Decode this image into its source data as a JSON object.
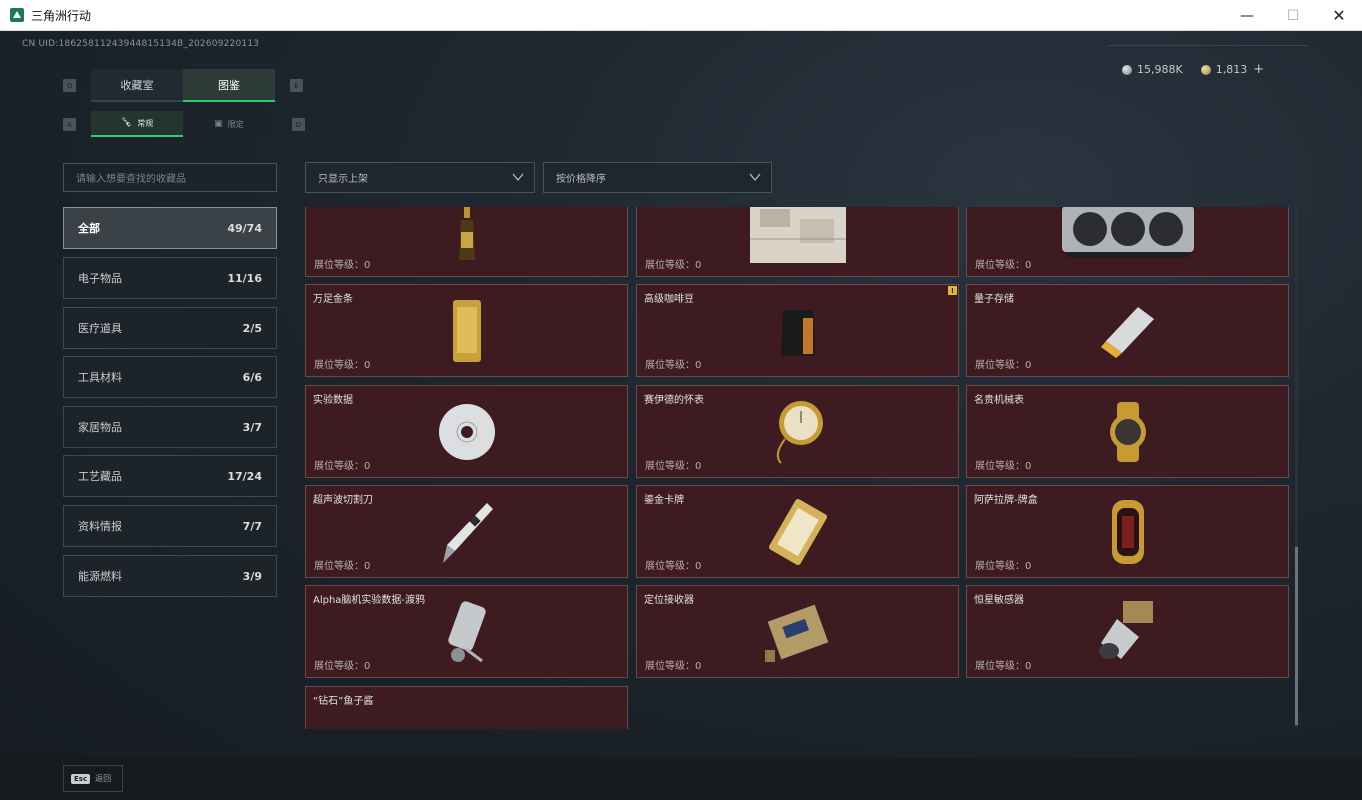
{
  "window": {
    "title": "三角洲行动"
  },
  "header": {
    "uid": "CN UID:18625811243944815134B_202609220113",
    "silver_amount": "15,988K",
    "gold_amount": "1,813",
    "add_symbol": "+"
  },
  "tabs": {
    "prev_key": "Q",
    "next_key": "E",
    "items": [
      {
        "label": "收藏室"
      },
      {
        "label": "图鉴"
      }
    ],
    "active_index": 1
  },
  "subtabs": {
    "prev_key": "A",
    "next_key": "D",
    "items": [
      {
        "label": "常规",
        "icon": "bottle-icon"
      },
      {
        "label": "限定",
        "icon": "frame-icon"
      }
    ],
    "active_index": 0
  },
  "search": {
    "placeholder": "请输入想要查找的收藏品"
  },
  "filters": {
    "display_filter": "只显示上架",
    "sort": "按价格降序"
  },
  "categories": [
    {
      "label": "全部",
      "count": "49/74"
    },
    {
      "label": "电子物品",
      "count": "11/16"
    },
    {
      "label": "医疗道具",
      "count": "2/5"
    },
    {
      "label": "工具材料",
      "count": "6/6"
    },
    {
      "label": "家居物品",
      "count": "3/7"
    },
    {
      "label": "工艺藏品",
      "count": "17/24"
    },
    {
      "label": "资料情报",
      "count": "7/7"
    },
    {
      "label": "能源燃料",
      "count": "3/9"
    }
  ],
  "active_category": 0,
  "level_label": "展位等级：0",
  "items": [
    {
      "name": "",
      "icon": "champagne-bottle-icon"
    },
    {
      "name": "",
      "icon": "map-document-icon"
    },
    {
      "name": "",
      "icon": "graphics-card-icon"
    },
    {
      "name": "万足金条",
      "icon": "gold-bar-icon"
    },
    {
      "name": "高级咖啡豆",
      "icon": "coffee-bag-icon",
      "badge": "!"
    },
    {
      "name": "量子存储",
      "icon": "usb-drive-icon"
    },
    {
      "name": "实验数据",
      "icon": "disc-icon"
    },
    {
      "name": "赛伊德的怀表",
      "icon": "pocket-watch-icon"
    },
    {
      "name": "名贵机械表",
      "icon": "wristwatch-icon"
    },
    {
      "name": "超声波切割刀",
      "icon": "cutter-knife-icon"
    },
    {
      "name": "鎏金卡牌",
      "icon": "gold-card-icon"
    },
    {
      "name": "阿萨拉牌-牌盒",
      "icon": "card-box-icon"
    },
    {
      "name": "Alpha脑机实验数据-渡鸦",
      "icon": "canister-icon"
    },
    {
      "name": "定位接收器",
      "icon": "receiver-icon"
    },
    {
      "name": "恒星敏感器",
      "icon": "sensor-icon"
    },
    {
      "name": "“钻石”鱼子酱",
      "icon": "caviar-tin-icon"
    }
  ],
  "bottom": {
    "esc_key": "Esc",
    "back_label": "返回"
  }
}
